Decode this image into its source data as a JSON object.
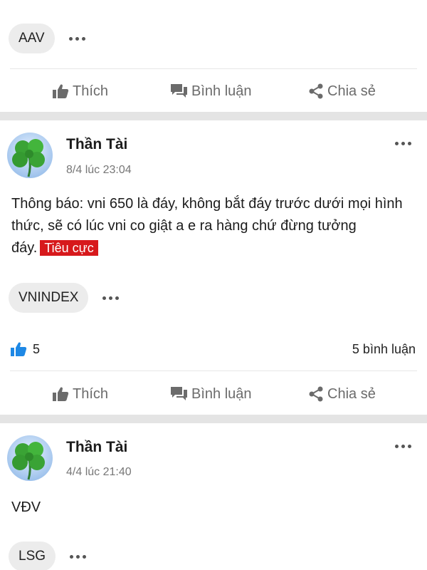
{
  "top_post": {
    "tag": "AAV",
    "actions": {
      "like": "Thích",
      "comment": "Bình luận",
      "share": "Chia sẻ"
    }
  },
  "post1": {
    "author": "Thần Tài",
    "time": "8/4 lúc 23:04",
    "content": "Thông báo: vni 650 là đáy, không bắt đáy trước dưới mọi hình thức, sẽ có lúc vni co giật a e ra hàng chứ đừng tưởng đáy.",
    "sentiment": "Tiêu cực",
    "tag": "VNINDEX",
    "like_count": "5",
    "comment_count": "5 bình luận",
    "actions": {
      "like": "Thích",
      "comment": "Bình luận",
      "share": "Chia sẻ"
    }
  },
  "post2": {
    "author": "Thần Tài",
    "time": "4/4 lúc 21:40",
    "content": "VĐV",
    "tag": "LSG"
  },
  "colors": {
    "sentiment_negative": "#d7191c",
    "like_blue": "#1e88e5",
    "clover_green": "#3aa335"
  }
}
